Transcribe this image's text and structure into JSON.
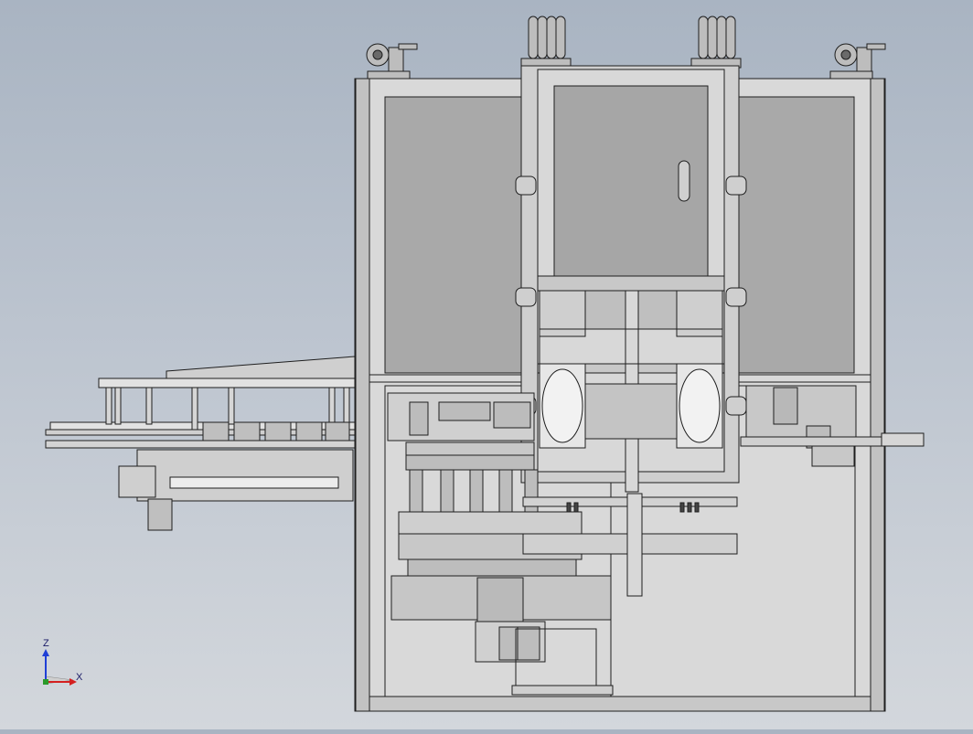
{
  "viewport": {
    "background_top": "#a9b4c2",
    "background_bottom": "#d3d7dc",
    "model_fill": "#d8d8d8",
    "model_fill_dark": "#a8a8a8",
    "model_edge": "#1e1e1e"
  },
  "triad": {
    "z_label": "Z",
    "x_label": "X",
    "z_color": "#1f3fd6",
    "x_color": "#d42020",
    "y_color": "#2a9a2a"
  }
}
